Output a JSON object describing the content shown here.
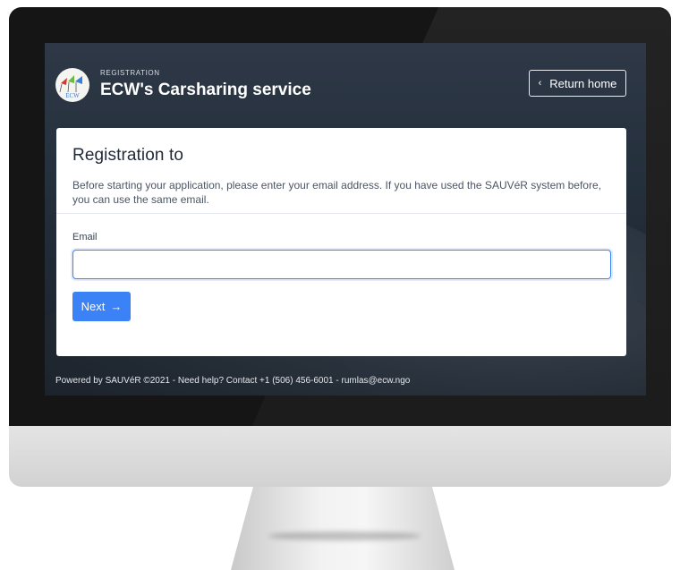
{
  "header": {
    "eyebrow": "REGISTRATION",
    "title": "ECW's Carsharing service",
    "logo_text": "ECW",
    "return_label": "Return home",
    "return_icon": "chevron-left-icon"
  },
  "card": {
    "title": "Registration to",
    "description": "Before starting your application, please enter your email address. If you have used the SAUVéR system before, you can use the same email.",
    "email_label": "Email",
    "email_value": "",
    "email_placeholder": "",
    "next_label": "Next",
    "next_icon": "arrow-right-icon"
  },
  "footer": {
    "text": "Powered by SAUVéR ©2021 - Need help? Contact +1 (506) 456-6001 - rumlas@ecw.ngo"
  },
  "colors": {
    "accent": "#3b82f6",
    "screen_background": "#25303d",
    "card_background": "#ffffff"
  }
}
